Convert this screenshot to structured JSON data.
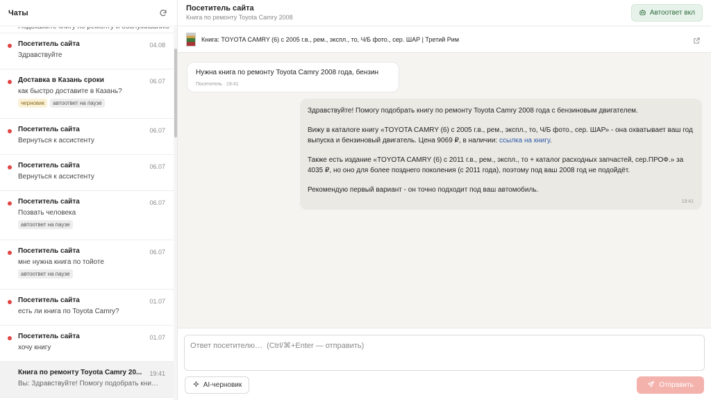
{
  "sidebar": {
    "title": "Чаты",
    "partial_preview": "Подскажите книгу по ремонту и обслуживанию",
    "items": [
      {
        "name": "Посетитель сайта",
        "date": "04.08",
        "preview": "Здравствуйте",
        "tags": [],
        "unread": true
      },
      {
        "name": "Доставка в Казань сроки",
        "date": "06.07",
        "preview": "как быстро доставите в Казань?",
        "tags": [
          "черновик",
          "автоответ на паузе"
        ],
        "unread": true
      },
      {
        "name": "Посетитель сайта",
        "date": "06.07",
        "preview": "Вернуться к ассистенту",
        "tags": [],
        "unread": true
      },
      {
        "name": "Посетитель сайта",
        "date": "06.07",
        "preview": "Вернуться к ассистенту",
        "tags": [],
        "unread": true
      },
      {
        "name": "Посетитель сайта",
        "date": "06.07",
        "preview": "Позвать человека",
        "tags": [
          "автоответ на паузе"
        ],
        "unread": true
      },
      {
        "name": "Посетитель сайта",
        "date": "06.07",
        "preview": "мне нужна книга по тойоте",
        "tags": [
          "автоответ на паузе"
        ],
        "unread": true
      },
      {
        "name": "Посетитель сайта",
        "date": "01.07",
        "preview": "есть ли книга по Toyota Camry?",
        "tags": [],
        "unread": true
      },
      {
        "name": "Посетитель сайта",
        "date": "01.07",
        "preview": "хочу книгу",
        "tags": [],
        "unread": true
      },
      {
        "name": "Книга по ремонту Toyota Camry 20...",
        "date": "19:41",
        "preview": "Вы: Здравствуйте! Помогу подобрать книгу по ремонту Toyota Camry",
        "tags": [],
        "unread": false
      }
    ]
  },
  "header": {
    "title": "Посетитель сайта",
    "subtitle": "Книга по ремонту Toyota Camry 2008",
    "autoreply_label": "Автоответ вкл"
  },
  "product": {
    "title": "Книга: TOYOTA CAMRY (6) с 2005 г.в., рем., экспл., то, Ч/Б фото., сер. ШАР | Третий Рим"
  },
  "messages": {
    "incoming": {
      "text": "Нужна книга по ремонту Toyota Camry 2008 года, бензин",
      "meta": "Посетитель · 19:41"
    },
    "outgoing": {
      "p1": "Здравствуйте! Помогу подобрать книгу по ремонту Toyota Camry 2008 года с бензиновым двигателем.",
      "p2": "Вижу в каталоге книгу «TOYOTA CAMRY (6) с 2005 г.в., рем., экспл., то, Ч/Б фото., сер. ШАР» - она охватывает ваш год выпуска и бензиновый двигатель. Цена 9069 ₽, в наличии: ",
      "p2_link": "ссылка на книгу",
      "p2_end": ".",
      "p3": "Также есть издание «TOYOTA CAMRY (6) с 2011 г.в., рем., экспл., то + каталог расходных запчастей, сер.ПРОФ.» за 4035 ₽, но оно для более позднего поколения (с 2011 года), поэтому под ваш 2008 год не подойдёт.",
      "p4": "Рекомендую первый вариант - он точно подходит под ваш автомобиль.",
      "time": "19:41"
    }
  },
  "composer": {
    "placeholder": "Ответ посетителю…  (Ctrl/⌘+Enter — отправить)",
    "ai_label": "AI-черновик",
    "send_label": "Отправить"
  },
  "colors": {
    "unread_dot": "#e04343",
    "link": "#2b5aa8",
    "send_button": "#f4b2ad",
    "autoreply_bg": "#e7f3ea"
  }
}
